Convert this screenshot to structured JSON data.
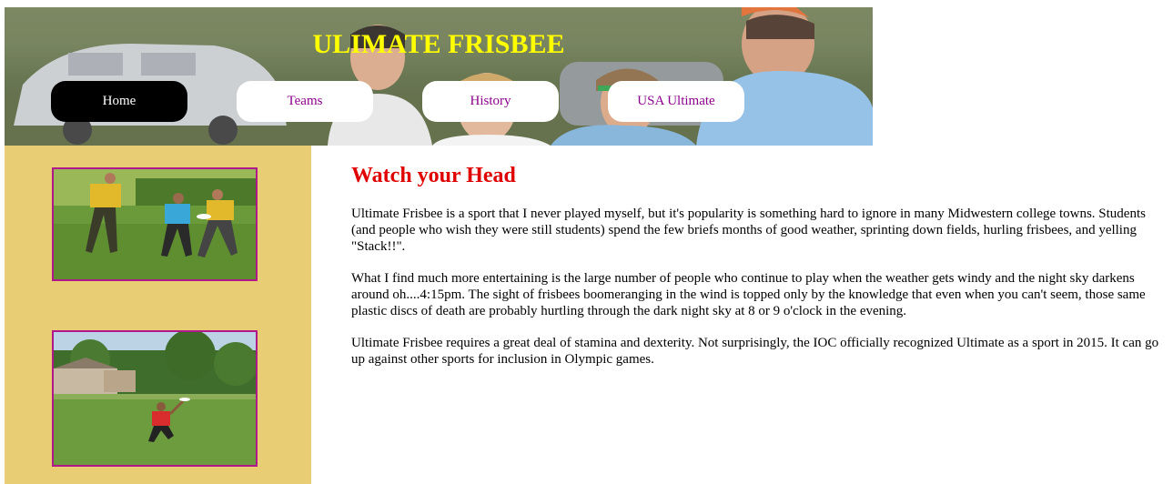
{
  "header": {
    "title": "ULIMATE FRISBEE"
  },
  "nav": {
    "items": [
      {
        "label": "Home",
        "active": true
      },
      {
        "label": "Teams",
        "active": false
      },
      {
        "label": "History",
        "active": false
      },
      {
        "label": "USA Ultimate",
        "active": false
      }
    ]
  },
  "sidebar": {
    "photos": [
      {
        "subject": "players in yellow and blue jerseys on grass field"
      },
      {
        "subject": "player catching frisbee on field with trees and houses"
      }
    ]
  },
  "main": {
    "heading": "Watch your Head",
    "paragraphs": [
      "Ultimate Frisbee is a sport that I never played myself, but it's popularity is something hard to ignore in many Midwestern college towns. Students (and people who wish they were still students) spend the few briefs months of good weather, sprinting down fields, hurling frisbees, and yelling \"Stack!!\".",
      "What I find much more entertaining is the large number of people who continue to play when the weather gets windy and the night sky darkens around oh....4:15pm. The sight of frisbees boomeranging in the wind is topped only by the knowledge that even when you can't seem, those same plastic discs of death are probably hurtling through the dark night sky at 8 or 9 o'clock in the evening.",
      "Ultimate Frisbee requires a great deal of stamina and dexterity. Not surprisingly, the IOC officially recognized Ultimate as a sport in 2015. It can go up against other sports for inclusion in Olympic games."
    ]
  },
  "colors": {
    "title": "#ffff00",
    "nav_active_bg": "#000000",
    "nav_active_text": "#ffffff",
    "nav_bg": "#ffffff",
    "nav_text": "#8b008b",
    "sidebar_bg": "#e8cd74",
    "photo_border": "#b0178a",
    "heading": "#e00000"
  }
}
